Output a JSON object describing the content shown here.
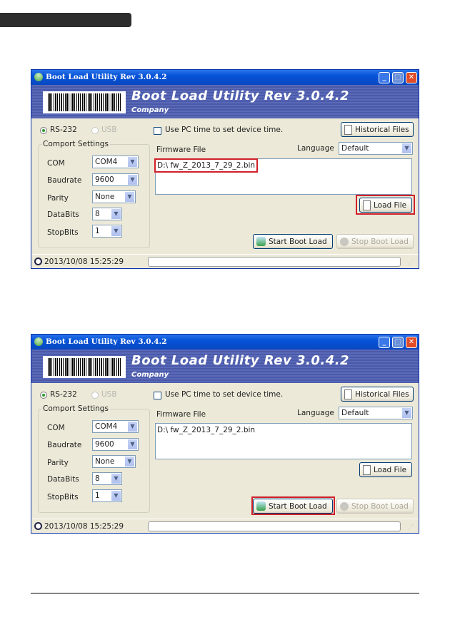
{
  "windows": [
    {
      "title": "Boot Load Utility Rev 3.0.4.2",
      "banner_title": "Boot Load Utility Rev 3.0.4.2",
      "banner_company": "Company",
      "rs232": "RS-232",
      "usb": "USB",
      "group_title": "Comport Settings",
      "com_label": "COM",
      "com_value": "COM4",
      "baud_label": "Baudrate",
      "baud_value": "9600",
      "parity_label": "Parity",
      "parity_value": "None",
      "databits_label": "DataBits",
      "databits_value": "8",
      "stopbits_label": "StopBits",
      "stopbits_value": "1",
      "use_pc_time": "Use PC time to set device time.",
      "historical": "Historical Files",
      "firmware_label": "Firmware File",
      "language_label": "Language",
      "language_value": "Default",
      "firmware_path": "D:\\ fw_Z_2013_7_29_2.bin",
      "load_file": "Load File",
      "start": "Start Boot Load",
      "stop": "Stop Boot Load",
      "datetime": "2013/10/08  15:25:29",
      "highlight": [
        "path",
        "load"
      ]
    },
    {
      "title": "Boot Load Utility Rev 3.0.4.2",
      "banner_title": "Boot Load Utility Rev 3.0.4.2",
      "banner_company": "Company",
      "rs232": "RS-232",
      "usb": "USB",
      "group_title": "Comport Settings",
      "com_label": "COM",
      "com_value": "COM4",
      "baud_label": "Baudrate",
      "baud_value": "9600",
      "parity_label": "Parity",
      "parity_value": "None",
      "databits_label": "DataBits",
      "databits_value": "8",
      "stopbits_label": "StopBits",
      "stopbits_value": "1",
      "use_pc_time": "Use PC time to set device time.",
      "historical": "Historical Files",
      "firmware_label": "Firmware File",
      "language_label": "Language",
      "language_value": "Default",
      "firmware_path": "D:\\ fw_Z_2013_7_29_2.bin",
      "load_file": "Load File",
      "start": "Start Boot Load",
      "stop": "Stop Boot Load",
      "datetime": "2013/10/08  15:25:29",
      "highlight": [
        "start"
      ]
    }
  ],
  "colors": {
    "highlight": "#d0202a",
    "titlebar": "#0553d8",
    "window_bg": "#ece9d8"
  }
}
